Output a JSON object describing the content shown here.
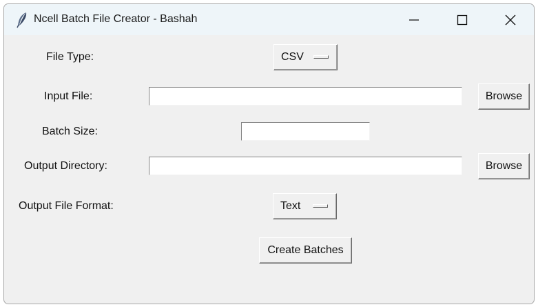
{
  "window": {
    "title": "Ncell Batch File Creator - Bashah",
    "icon": "feather-icon"
  },
  "form": {
    "file_type_label": "File Type:",
    "file_type_value": "CSV",
    "input_file_label": "Input File:",
    "input_file_value": "",
    "input_browse_label": "Browse",
    "batch_size_label": "Batch Size:",
    "batch_size_value": "",
    "output_dir_label": "Output Directory:",
    "output_dir_value": "",
    "output_browse_label": "Browse",
    "output_format_label": "Output File Format:",
    "output_format_value": "Text",
    "create_button_label": "Create Batches"
  }
}
